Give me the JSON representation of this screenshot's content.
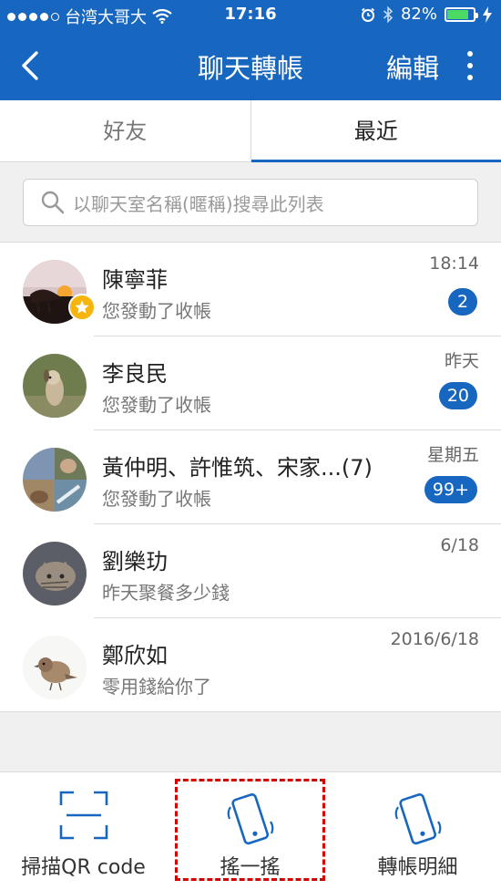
{
  "status_bar": {
    "carrier": "台湾大哥大",
    "time": "17:16",
    "battery_percent": "82%",
    "battery_level": 0.82,
    "icons": [
      "signal-dots-icon",
      "wifi-icon",
      "alarm-icon",
      "bluetooth-icon",
      "battery-icon",
      "charging-icon"
    ]
  },
  "nav": {
    "title": "聊天轉帳",
    "edit_label": "編輯",
    "icons": [
      "back-chevron-icon",
      "more-vertical-icon"
    ]
  },
  "tabs": [
    {
      "label": "好友",
      "active": false
    },
    {
      "label": "最近",
      "active": true
    }
  ],
  "search": {
    "placeholder": "以聊天室名稱(暱稱)搜尋此列表",
    "icon": "search-icon"
  },
  "conversations": [
    {
      "name": "陳寧菲",
      "preview": "您發動了收帳",
      "time": "18:14",
      "badge": "2",
      "starred": true
    },
    {
      "name": "李良民",
      "preview": "您發動了收帳",
      "time": "昨天",
      "badge": "20",
      "starred": false
    },
    {
      "name": "黃仲明、許惟筑、宋家...(7)",
      "preview": "您發動了收帳",
      "time": "星期五",
      "badge": "99+",
      "starred": false
    },
    {
      "name": "劉樂玏",
      "preview": "昨天聚餐多少錢",
      "time": "6/18",
      "badge": "",
      "starred": false
    },
    {
      "name": "鄭欣如",
      "preview": "零用錢給你了",
      "time": "2016/6/18",
      "badge": "",
      "starred": false
    }
  ],
  "bottom_bar": {
    "items": [
      {
        "label": "掃描QR code",
        "icon": "qr-scan-icon"
      },
      {
        "label": "搖一搖",
        "icon": "shake-phone-icon",
        "highlighted": true
      },
      {
        "label": "轉帳明細",
        "icon": "transfer-details-icon"
      }
    ]
  },
  "colors": {
    "brand": "#1767c0",
    "star": "#f5b50c",
    "battery": "#4cd964",
    "highlight": "#d40000"
  }
}
